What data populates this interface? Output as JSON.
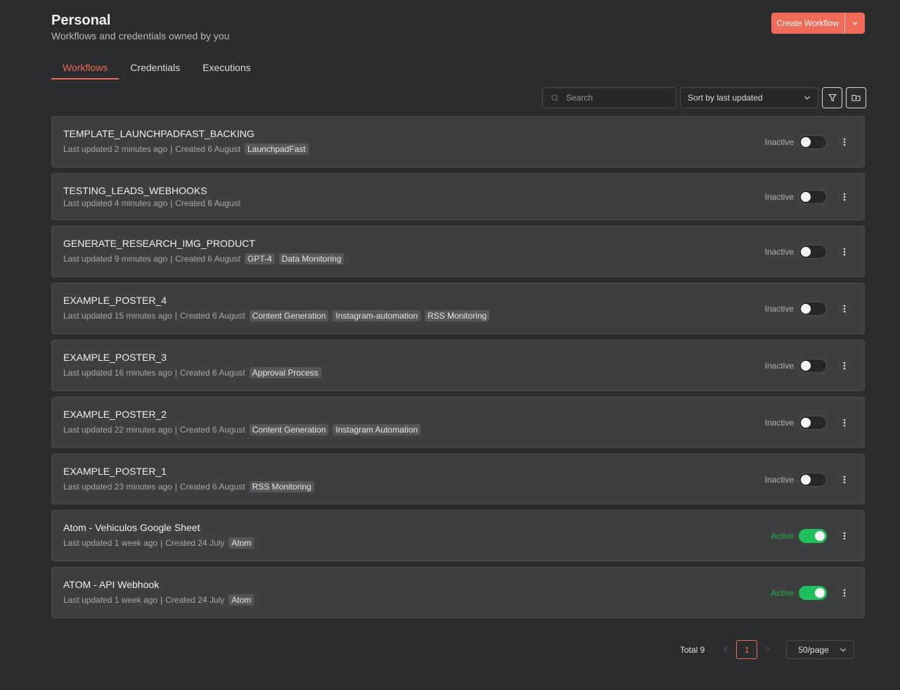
{
  "header": {
    "title": "Personal",
    "subtitle": "Workflows and credentials owned by you",
    "create_label": "Create Workflow"
  },
  "tabs": [
    {
      "label": "Workflows",
      "active": true
    },
    {
      "label": "Credentials",
      "active": false
    },
    {
      "label": "Executions",
      "active": false
    }
  ],
  "toolbar": {
    "search_placeholder": "Search",
    "sort_label": "Sort by last updated"
  },
  "workflows": [
    {
      "name": "TEMPLATE_LAUNCHPADFAST_BACKING",
      "updated": "Last updated 2 minutes ago",
      "created": "Created 6 August",
      "tags": [
        "LaunchpadFast"
      ],
      "status": "Inactive",
      "active": false
    },
    {
      "name": "TESTING_LEADS_WEBHOOKS",
      "updated": "Last updated 4 minutes ago",
      "created": "Created 6 August",
      "tags": [],
      "status": "Inactive",
      "active": false
    },
    {
      "name": "GENERATE_RESEARCH_IMG_PRODUCT",
      "updated": "Last updated 9 minutes ago",
      "created": "Created 6 August",
      "tags": [
        "GPT-4",
        "Data Monitoring"
      ],
      "status": "Inactive",
      "active": false
    },
    {
      "name": "EXAMPLE_POSTER_4",
      "updated": "Last updated 15 minutes ago",
      "created": "Created 6 August",
      "tags": [
        "Content Generation",
        "Instagram-automation",
        "RSS Monitoring"
      ],
      "status": "Inactive",
      "active": false
    },
    {
      "name": "EXAMPLE_POSTER_3",
      "updated": "Last updated 16 minutes ago",
      "created": "Created 6 August",
      "tags": [
        "Approval Process"
      ],
      "status": "Inactive",
      "active": false
    },
    {
      "name": "EXAMPLE_POSTER_2",
      "updated": "Last updated 22 minutes ago",
      "created": "Created 6 August",
      "tags": [
        "Content Generation",
        "Instagram Automation"
      ],
      "status": "Inactive",
      "active": false
    },
    {
      "name": "EXAMPLE_POSTER_1",
      "updated": "Last updated 23 minutes ago",
      "created": "Created 6 August",
      "tags": [
        "RSS Monitoring"
      ],
      "status": "Inactive",
      "active": false
    },
    {
      "name": "Atom - Vehiculos Google Sheet",
      "updated": "Last updated 1 week ago",
      "created": "Created 24 July",
      "tags": [
        "Atom"
      ],
      "status": "Active",
      "active": true
    },
    {
      "name": "ATOM - API Webhook",
      "updated": "Last updated 1 week ago",
      "created": "Created 24 July",
      "tags": [
        "Atom"
      ],
      "status": "Active",
      "active": true
    }
  ],
  "pagination": {
    "total_label": "Total 9",
    "current_page": "1",
    "page_size": "50/page"
  },
  "colors": {
    "accent": "#ef6a57",
    "active_green": "#1fbf5c",
    "background": "#2b2c2d",
    "card": "#3e3f41"
  }
}
